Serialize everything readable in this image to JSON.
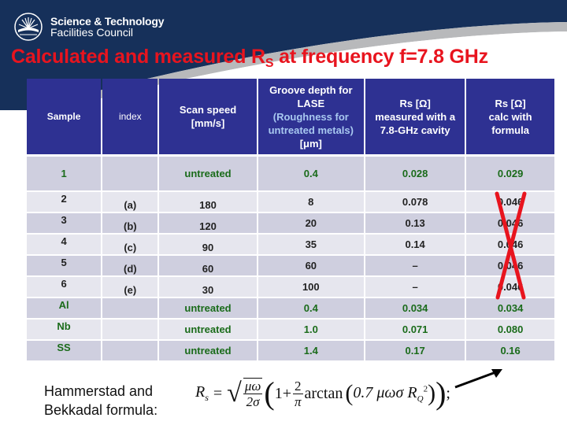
{
  "header": {
    "org_name_line1": "Science & Technology",
    "org_name_line2": "Facilities Council",
    "logo_icon": "sunburst-logo-icon",
    "title_main": "Calculated and measured R",
    "title_sub": "S",
    "title_rest": " at frequency f=7.8 GHz",
    "colors": {
      "banner": "#16305a",
      "title": "#e8141e",
      "table_header": "#2e3192",
      "green_text": "#1a6b1a",
      "cross": "#e8141e"
    }
  },
  "table": {
    "columns": [
      {
        "label": "Sample"
      },
      {
        "label": "index"
      },
      {
        "label": "Scan speed [mm/s]"
      },
      {
        "line1": "Groove depth for",
        "line2": "LASE",
        "line3": "(Roughness for",
        "line4": "untreated metals)",
        "line5": "[μm]"
      },
      {
        "line1": "Rs [Ω]",
        "line2": "measured with a",
        "line3": "7.8-GHz cavity"
      },
      {
        "line1": "Rs [Ω]",
        "line2": "calc with",
        "line3": "formula"
      }
    ],
    "rows": [
      {
        "sample": "1",
        "index": "",
        "scan_speed": "untreated",
        "groove_depth": "0.4",
        "rs_measured": "0.028",
        "rs_calc": "0.029",
        "style": "green"
      },
      {
        "sample": "2",
        "index": "(a)",
        "scan_speed": "180",
        "groove_depth": "8",
        "rs_measured": "0.078",
        "rs_calc": "0.046",
        "style": "normal"
      },
      {
        "sample": "3",
        "index": "(b)",
        "scan_speed": "120",
        "groove_depth": "20",
        "rs_measured": "0.13",
        "rs_calc": "0.046",
        "style": "normal"
      },
      {
        "sample": "4",
        "index": "(c)",
        "scan_speed": "90",
        "groove_depth": "35",
        "rs_measured": "0.14",
        "rs_calc": "0.046",
        "style": "normal"
      },
      {
        "sample": "5",
        "index": "(d)",
        "scan_speed": "60",
        "groove_depth": "60",
        "rs_measured": "–",
        "rs_calc": "0.046",
        "style": "normal"
      },
      {
        "sample": "6",
        "index": "(e)",
        "scan_speed": "30",
        "groove_depth": "100",
        "rs_measured": "–",
        "rs_calc": "0.046",
        "style": "normal"
      },
      {
        "sample": "Al",
        "index": "",
        "scan_speed": "untreated",
        "groove_depth": "0.4",
        "rs_measured": "0.034",
        "rs_calc": "0.034",
        "style": "green"
      },
      {
        "sample": "Nb",
        "index": "",
        "scan_speed": "untreated",
        "groove_depth": "1.0",
        "rs_measured": "0.071",
        "rs_calc": "0.080",
        "style": "green"
      },
      {
        "sample": "SS",
        "index": "",
        "scan_speed": "untreated",
        "groove_depth": "1.4",
        "rs_measured": "0.17",
        "rs_calc": "0.16",
        "style": "green"
      }
    ],
    "crossed_out_rows": [
      "2",
      "3",
      "4",
      "5",
      "6"
    ]
  },
  "footer": {
    "label_line1": "Hammerstad and",
    "label_line2": "Bekkadal formula:",
    "formula": {
      "lhs": "R",
      "lhs_sub": "s",
      "equals": "=",
      "sqrt_num": "μω",
      "sqrt_den": "2σ",
      "one_plus": "1+",
      "frac_num": "2",
      "frac_den": "π",
      "func": "arctan",
      "arg": "0.7 μωσ R",
      "arg_sub": "Q",
      "arg_sup": "2",
      "end": ";"
    },
    "arrow_icon": "arrow-icon"
  }
}
